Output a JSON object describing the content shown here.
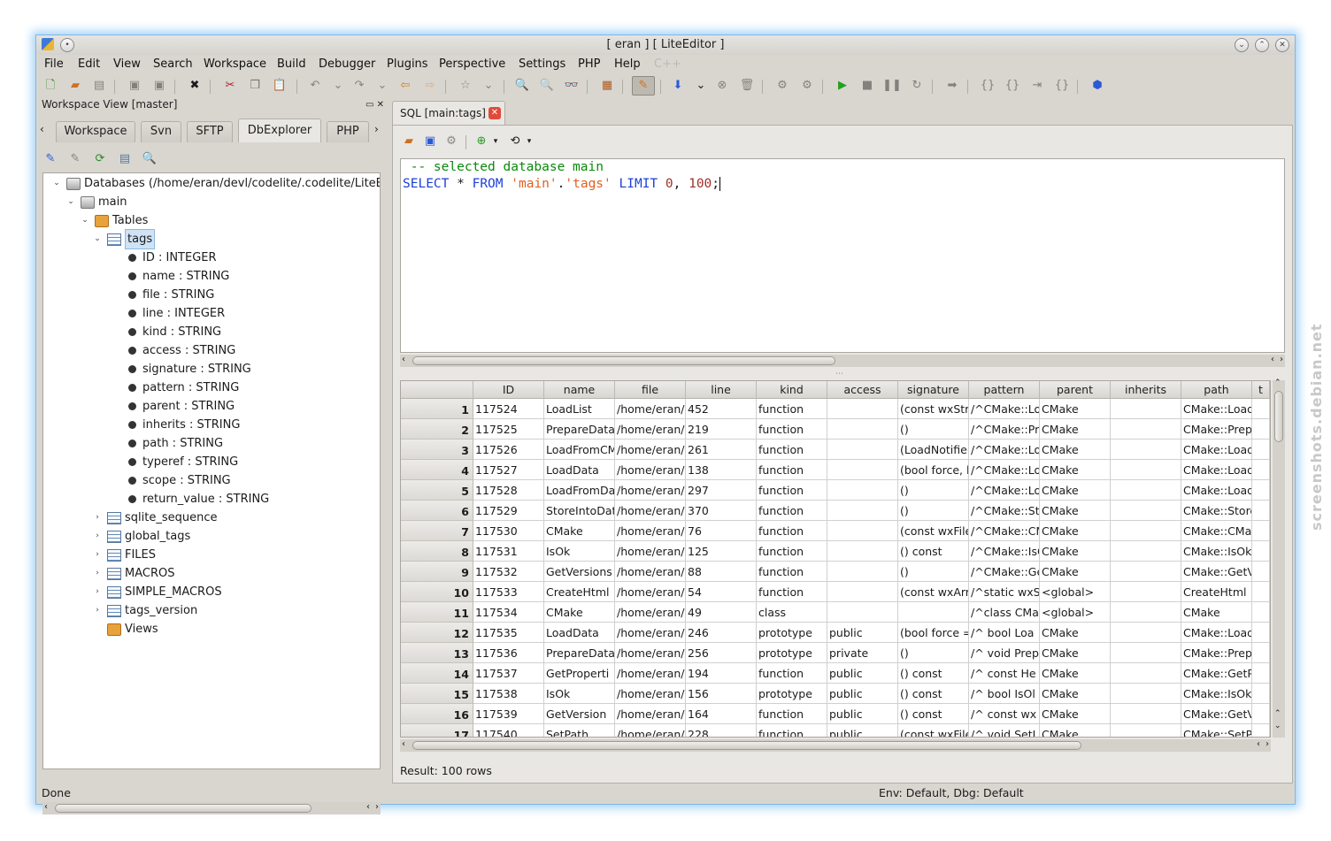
{
  "window": {
    "title": "[ eran ] [ LiteEditor ]"
  },
  "menu": [
    "File",
    "Edit",
    "View",
    "Search",
    "Workspace",
    "Build",
    "Debugger",
    "Plugins",
    "Perspective",
    "Settings",
    "PHP",
    "Help"
  ],
  "menu_disabled": "C++",
  "left_panel": {
    "header": "Workspace View [master]",
    "tabs": [
      "Workspace",
      "Svn",
      "SFTP",
      "DbExplorer",
      "PHP"
    ],
    "active_tab": "DbExplorer",
    "tree": {
      "root": "Databases (/home/eran/devl/codelite/.codelite/LiteE",
      "db": "main",
      "tables_folder": "Tables",
      "selected_table": "tags",
      "columns": [
        "ID : INTEGER",
        "name : STRING",
        "file : STRING",
        "line : INTEGER",
        "kind : STRING",
        "access : STRING",
        "signature : STRING",
        "pattern : STRING",
        "parent : STRING",
        "inherits : STRING",
        "path : STRING",
        "typeref : STRING",
        "scope : STRING",
        "return_value : STRING"
      ],
      "other_tables": [
        "sqlite_sequence",
        "global_tags",
        "FILES",
        "MACROS",
        "SIMPLE_MACROS",
        "tags_version"
      ],
      "views_folder": "Views"
    }
  },
  "editor_tab": {
    "label": "SQL [main:tags]"
  },
  "editor": {
    "line1": " -- selected database main",
    "kw_select": "SELECT",
    "star": " * ",
    "kw_from": "FROM",
    "str_main": "'main'",
    "dot": ".",
    "str_tags": "'tags'",
    "kw_limit": "LIMIT",
    "num_0": "0",
    "comma": ", ",
    "num_100": "100",
    "semi": ";"
  },
  "grid": {
    "columns": [
      "ID",
      "name",
      "file",
      "line",
      "kind",
      "access",
      "signature",
      "pattern",
      "parent",
      "inherits",
      "path",
      "t"
    ],
    "rows": [
      [
        "1",
        "117524",
        "LoadList",
        "/home/eran/",
        "452",
        "function",
        "",
        "(const wxStr",
        "/^CMake::Lo",
        "CMake",
        "",
        "CMake::LoadList"
      ],
      [
        "2",
        "117525",
        "PrepareData",
        "/home/eran/",
        "219",
        "function",
        "",
        "()",
        "/^CMake::Pre",
        "CMake",
        "",
        "CMake::Prepare"
      ],
      [
        "3",
        "117526",
        "LoadFromCM",
        "/home/eran/",
        "261",
        "function",
        "",
        "(LoadNotifie",
        "/^CMake::Lo",
        "CMake",
        "",
        "CMake::LoadFro"
      ],
      [
        "4",
        "117527",
        "LoadData",
        "/home/eran/",
        "138",
        "function",
        "",
        "(bool force, l",
        "/^CMake::Lo",
        "CMake",
        "",
        "CMake::LoadDat"
      ],
      [
        "5",
        "117528",
        "LoadFromDa",
        "/home/eran/",
        "297",
        "function",
        "",
        "()",
        "/^CMake::Lo",
        "CMake",
        "",
        "CMake::LoadFro"
      ],
      [
        "6",
        "117529",
        "StoreIntoDat",
        "/home/eran/",
        "370",
        "function",
        "",
        "()",
        "/^CMake::Sto",
        "CMake",
        "",
        "CMake::StoreInt"
      ],
      [
        "7",
        "117530",
        "CMake",
        "/home/eran/",
        "76",
        "function",
        "",
        "(const wxFile",
        "/^CMake::CM",
        "CMake",
        "",
        "CMake::CMake"
      ],
      [
        "8",
        "117531",
        "IsOk",
        "/home/eran/",
        "125",
        "function",
        "",
        "() const",
        "/^CMake::IsC",
        "CMake",
        "",
        "CMake::IsOk"
      ],
      [
        "9",
        "117532",
        "GetVersions",
        "/home/eran/",
        "88",
        "function",
        "",
        "()",
        "/^CMake::Ge",
        "CMake",
        "",
        "CMake::GetVers"
      ],
      [
        "10",
        "117533",
        "CreateHtml",
        "/home/eran/",
        "54",
        "function",
        "",
        "(const wxArr",
        "/^static wxSt",
        "<global>",
        "",
        "CreateHtml"
      ],
      [
        "11",
        "117534",
        "CMake",
        "/home/eran/",
        "49",
        "class",
        "",
        "",
        "/^class CMak",
        "<global>",
        "",
        "CMake"
      ],
      [
        "12",
        "117535",
        "LoadData",
        "/home/eran/",
        "246",
        "prototype",
        "public",
        "(bool force =",
        "/^   bool Loa",
        "CMake",
        "",
        "CMake::LoadDat"
      ],
      [
        "13",
        "117536",
        "PrepareData",
        "/home/eran/",
        "256",
        "prototype",
        "private",
        "()",
        "/^   void Prep",
        "CMake",
        "",
        "CMake::Prepare"
      ],
      [
        "14",
        "117537",
        "GetProperti",
        "/home/eran/",
        "194",
        "function",
        "public",
        "() const",
        "/^   const He",
        "CMake",
        "",
        "CMake::GetProp"
      ],
      [
        "15",
        "117538",
        "IsOk",
        "/home/eran/",
        "156",
        "prototype",
        "public",
        "() const",
        "/^   bool IsOl",
        "CMake",
        "",
        "CMake::IsOk"
      ],
      [
        "16",
        "117539",
        "GetVersion",
        "/home/eran/",
        "164",
        "function",
        "public",
        "() const",
        "/^   const wx",
        "CMake",
        "",
        "CMake::GetVers"
      ],
      [
        "17",
        "117540",
        "SetPath",
        "/home/eran/",
        "228",
        "function",
        "public",
        "(const wxFile",
        "/^   void SetI",
        "CMake",
        "",
        "CMake::SetPath"
      ]
    ]
  },
  "result": "Result: 100 rows",
  "status": {
    "left": "Done",
    "right": "Env: Default, Dbg: Default"
  },
  "watermark": "screenshots.debian.net"
}
